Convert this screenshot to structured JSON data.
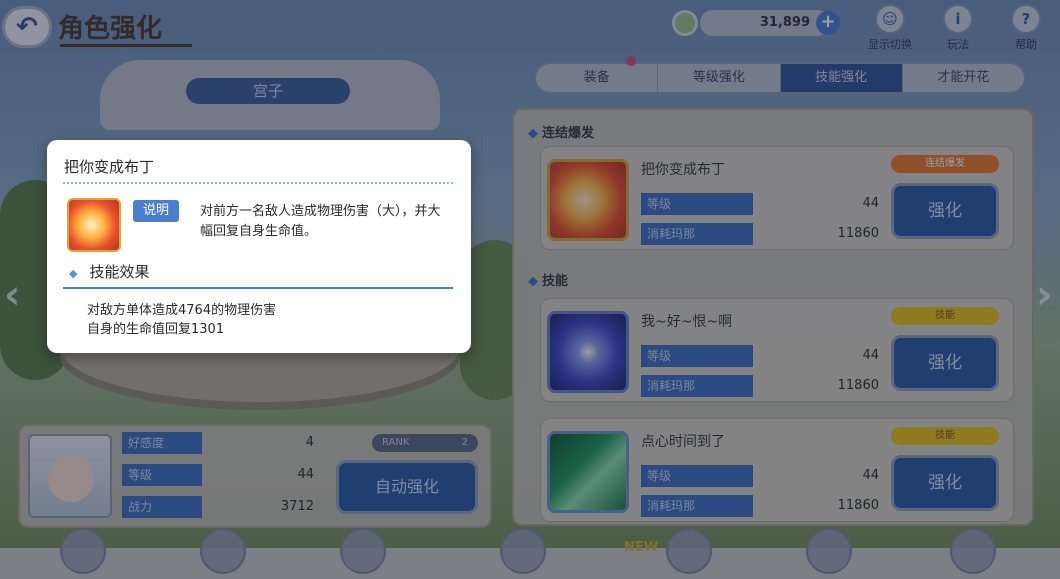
{
  "header": {
    "back_icon": "↶",
    "title": "角色强化",
    "currency_value": "31,899",
    "plus": "+",
    "buttons": [
      {
        "label": "显示切换",
        "icon": "☺"
      },
      {
        "label": "玩法",
        "icon": "i"
      },
      {
        "label": "帮助",
        "icon": "?"
      }
    ]
  },
  "stage_name": "宫子",
  "tabs": [
    "装备",
    "等级强化",
    "技能强化",
    "才能开花"
  ],
  "active_tab": "技能强化",
  "sections": {
    "union_burst": "连结爆发",
    "skills": "技能"
  },
  "skill_cards": [
    {
      "name": "把你变成布丁",
      "badge": "连结爆发",
      "level_label": "等级",
      "level": "44",
      "cost_label": "消耗玛那",
      "cost": "11860",
      "button": "强化"
    },
    {
      "name": "我~好~恨~啊",
      "badge": "技能",
      "level_label": "等级",
      "level": "44",
      "cost_label": "消耗玛那",
      "cost": "11860",
      "button": "强化"
    },
    {
      "name": "点心时间到了",
      "badge": "技能",
      "level_label": "等级",
      "level": "44",
      "cost_label": "消耗玛那",
      "cost": "11860",
      "button": "强化"
    }
  ],
  "character": {
    "stats": [
      {
        "label": "好感度",
        "value": "4"
      },
      {
        "label": "等级",
        "value": "44"
      },
      {
        "label": "战力",
        "value": "3712"
      }
    ],
    "rank_label": "RANK",
    "rank_value": "2",
    "auto_button": "自动强化"
  },
  "popup": {
    "title": "把你变成布丁",
    "desc_badge": "说明",
    "description": "对前方一名敌人造成物理伤害（大），并大幅回复自身生命值。",
    "effect_header": "技能效果",
    "effect_lines": [
      "对敌方单体造成4764的物理伤害",
      "自身的生命值回复1301"
    ]
  },
  "bottom_nav": {
    "new_label": "NEW"
  },
  "arrows": {
    "left": "‹",
    "right": "›"
  }
}
